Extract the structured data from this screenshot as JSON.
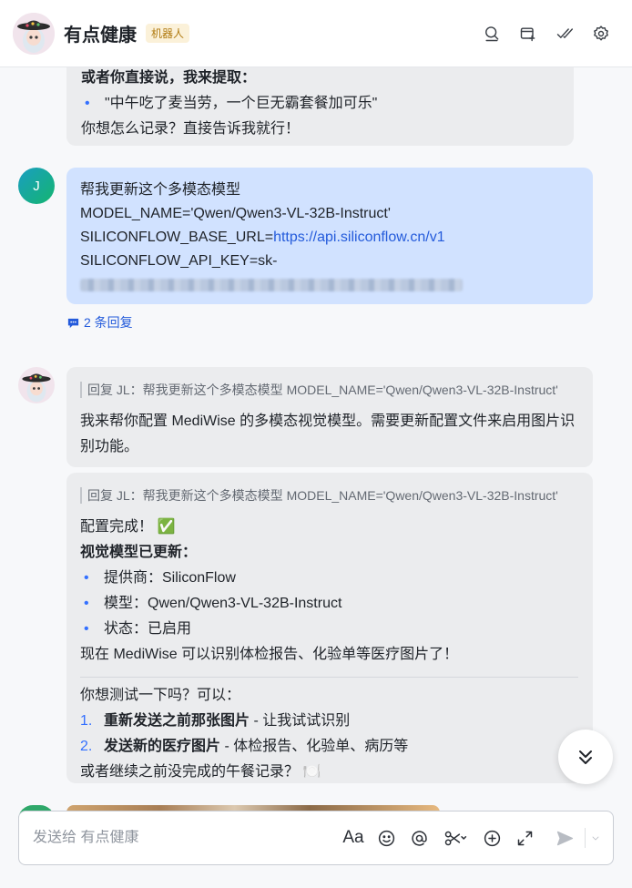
{
  "header": {
    "title": "有点健康",
    "badge": "机器人",
    "actions": [
      "search-icon",
      "add-tab-icon",
      "mark-done-icon",
      "settings-icon"
    ]
  },
  "messages": {
    "m1": {
      "heading": "或者你直接说，我来提取：",
      "bullet": "\"中午吃了麦当劳，一个巨无霸套餐加可乐\"",
      "footer": "你想怎么记录？直接告诉我就行！"
    },
    "m2": {
      "avatar_initial": "J",
      "line1": "帮我更新这个多模态模型",
      "line2": "MODEL_NAME='Qwen/Qwen3-VL-32B-Instruct'",
      "line3_prefix": "SILICONFLOW_BASE_URL=",
      "line3_link": "https://api.siliconflow.cn/v1",
      "line4": "SILICONFLOW_API_KEY=sk-",
      "replies": "2 条回复"
    },
    "m3": {
      "quote": "回复 JL：帮我更新这个多模态模型 MODEL_NAME='Qwen/Qwen3-VL-32B-Instruct'",
      "text": "我来帮你配置 MediWise 的多模态视觉模型。需要更新配置文件来启用图片识别功能。"
    },
    "m4": {
      "quote": "回复 JL：帮我更新这个多模态模型 MODEL_NAME='Qwen/Qwen3-VL-32B-Instruct'",
      "done": "配置完成！",
      "done_emoji": "✅",
      "subheading": "视觉模型已更新：",
      "items": [
        "提供商：SiliconFlow",
        "模型：Qwen/Qwen3-VL-32B-Instruct",
        "状态：已启用"
      ],
      "summary": "现在 MediWise 可以识别体检报告、化验单等医疗图片了！",
      "ask": "你想测试一下吗？可以：",
      "options": [
        {
          "num": "1.",
          "bold": "重新发送之前那张图片",
          "rest": " - 让我试试识别"
        },
        {
          "num": "2.",
          "bold": "发送新的医疗图片",
          "rest": " - 体检报告、化验单、病历等"
        }
      ],
      "closing": "或者继续之前没完成的午餐记录？",
      "closing_emoji": "🍽️"
    }
  },
  "composer": {
    "placeholder": "发送给 有点健康",
    "format_label": "Aa"
  },
  "colors": {
    "accent": "#3370ff",
    "user_bubble": "#d1e2ff",
    "bot_bubble": "#ebecee",
    "badge_bg": "#fbf1d9"
  }
}
